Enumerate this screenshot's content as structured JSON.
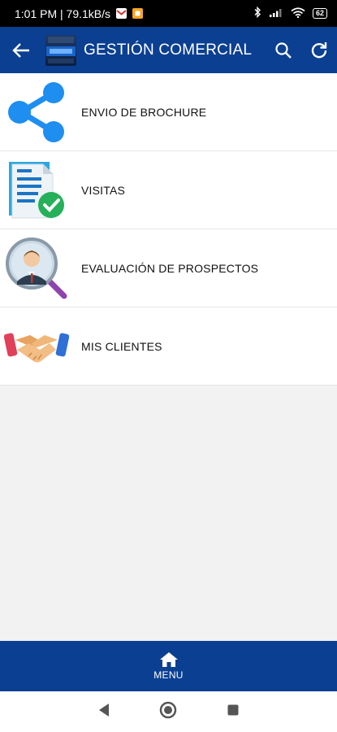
{
  "status_bar": {
    "time_speed": "1:01 PM | 79.1kB/s",
    "battery": "62",
    "icons": [
      "gmail-icon",
      "notification-app-icon",
      "bluetooth-icon",
      "signal-icon",
      "wifi-icon",
      "battery-icon"
    ]
  },
  "app_bar": {
    "title": "GESTIÓN COMERCIAL",
    "icons": [
      "back-arrow-icon",
      "app-logo",
      "search-icon",
      "refresh-icon"
    ]
  },
  "menu_items": [
    {
      "label": "ENVIO DE BROCHURE",
      "icon": "share-icon"
    },
    {
      "label": "VISITAS",
      "icon": "document-check-icon"
    },
    {
      "label": "EVALUACIÓN DE PROSPECTOS",
      "icon": "person-magnifier-icon"
    },
    {
      "label": "MIS CLIENTES",
      "icon": "handshake-icon"
    }
  ],
  "bottom_nav": {
    "label": "MENU",
    "icon": "home-icon"
  },
  "system_nav": {
    "icons": [
      "back-triangle-icon",
      "home-circle-icon",
      "recents-square-icon"
    ]
  },
  "colors": {
    "app_bar": "#0b3f91",
    "status_bar": "#000000",
    "background": "#f2f2f2",
    "share_blue": "#1e8ef0"
  }
}
